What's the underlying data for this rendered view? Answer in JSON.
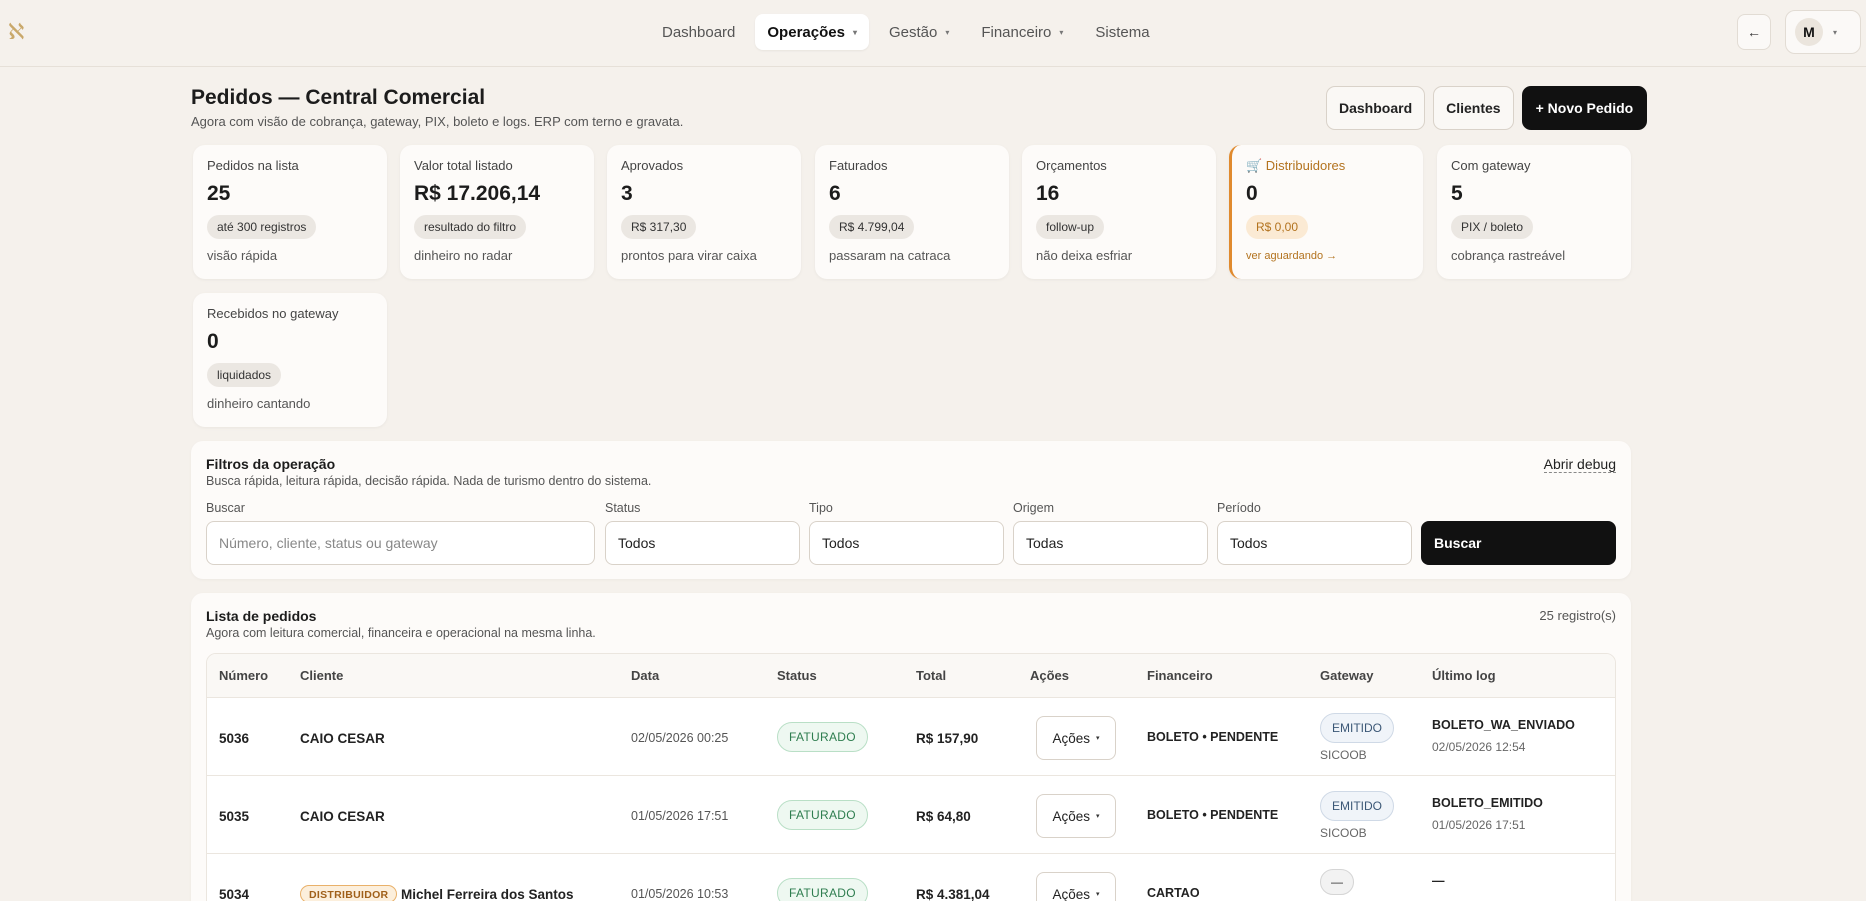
{
  "nav": {
    "items": [
      {
        "label": "Dashboard",
        "active": false,
        "dropdown": false
      },
      {
        "label": "Operações",
        "active": true,
        "dropdown": true
      },
      {
        "label": "Gestão",
        "active": false,
        "dropdown": true
      },
      {
        "label": "Financeiro",
        "active": false,
        "dropdown": true
      },
      {
        "label": "Sistema",
        "active": false,
        "dropdown": false
      }
    ],
    "back_label": "←",
    "user_initial": "M",
    "caret": "▾"
  },
  "header": {
    "title": "Pedidos — Central Comercial",
    "subtitle": "Agora com visão de cobrança, gateway, PIX, boleto e logs. ERP com terno e gravata.",
    "actions": {
      "dashboard": "Dashboard",
      "clientes": "Clientes",
      "novo_pedido": "+ Novo Pedido"
    }
  },
  "cards": [
    {
      "label": "Pedidos na lista",
      "value": "25",
      "chip": "até 300 registros",
      "note": "visão rápida"
    },
    {
      "label": "Valor total listado",
      "value": "R$ 17.206,14",
      "chip": "resultado do filtro",
      "note": "dinheiro no radar"
    },
    {
      "label": "Aprovados",
      "value": "3",
      "chip": "R$ 317,30",
      "note": "prontos para virar caixa"
    },
    {
      "label": "Faturados",
      "value": "6",
      "chip": "R$ 4.799,04",
      "note": "passaram na catraca"
    },
    {
      "label": "Orçamentos",
      "value": "16",
      "chip": "follow-up",
      "note": "não deixa esfriar"
    },
    {
      "label": "🛒 Distribuidores",
      "value": "0",
      "chip": "R$ 0,00",
      "note": "ver aguardando →"
    },
    {
      "label": "Com gateway",
      "value": "5",
      "chip": "PIX / boleto",
      "note": "cobrança rastreável"
    },
    {
      "label": "Recebidos no gateway",
      "value": "0",
      "chip": "liquidados",
      "note": "dinheiro cantando"
    }
  ],
  "filters": {
    "title": "Filtros da operação",
    "subtitle": "Busca rápida, leitura rápida, decisão rápida. Nada de turismo dentro do sistema.",
    "debug_link": "Abrir debug",
    "search_label": "Buscar",
    "search_placeholder": "Número, cliente, status ou gateway",
    "status_label": "Status",
    "status_value": "Todos",
    "tipo_label": "Tipo",
    "tipo_value": "Todos",
    "origem_label": "Origem",
    "origem_value": "Todas",
    "periodo_label": "Período",
    "periodo_value": "Todos",
    "search_button": "Buscar"
  },
  "orders": {
    "title": "Lista de pedidos",
    "subtitle": "Agora com leitura comercial, financeira e operacional na mesma linha.",
    "count": "25 registro(s)",
    "columns": [
      "Número",
      "Cliente",
      "Data",
      "Status",
      "Total",
      "Ações",
      "Financeiro",
      "Gateway",
      "Último log"
    ],
    "action_label": "Ações",
    "rows": [
      {
        "numero": "5036",
        "cliente": "CAIO CESAR",
        "data": "02/05/2026 00:25",
        "status": "FATURADO",
        "total": "R$ 157,90",
        "financeiro": "BOLETO • PENDENTE",
        "gateway": "EMITIDO",
        "gateway_sub": "SICOOB",
        "log": "BOLETO_WA_ENVIADO",
        "log_date": "02/05/2026 12:54"
      },
      {
        "numero": "5035",
        "cliente": "CAIO CESAR",
        "data": "01/05/2026 17:51",
        "status": "FATURADO",
        "total": "R$ 64,80",
        "financeiro": "BOLETO • PENDENTE",
        "gateway": "EMITIDO",
        "gateway_sub": "SICOOB",
        "log": "BOLETO_EMITIDO",
        "log_date": "01/05/2026 17:51"
      },
      {
        "numero": "5034",
        "badge": "DISTRIBUIDOR",
        "cliente": "Michel Ferreira dos Santos",
        "data": "01/05/2026 10:53",
        "status": "FATURADO",
        "total": "R$ 4.381,04",
        "financeiro": "CARTAO",
        "gateway": "—",
        "log": "—"
      }
    ]
  }
}
